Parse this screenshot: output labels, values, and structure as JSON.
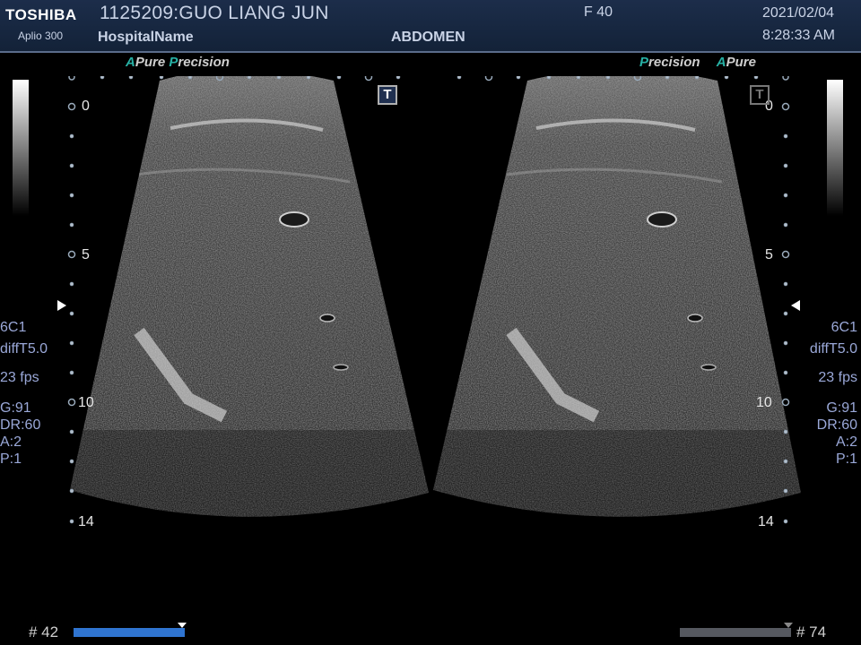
{
  "header": {
    "logo": "TOSHIBA",
    "model": "Aplio 300",
    "patient": "1125209:GUO LIANG JUN",
    "hospital": "HospitalName",
    "frame_rate_label": "F 40",
    "preset": "ABDOMEN",
    "date": "2021/02/04",
    "time": "8:28:33 AM"
  },
  "brand_left": {
    "a": "A",
    "pure": "Pure",
    "p": "P",
    "precision": "recision"
  },
  "brand_right": {
    "p": "P",
    "precision": "recision",
    "a": "A",
    "pure": "Pure"
  },
  "scale": {
    "d0": "0",
    "d5": "5",
    "d10": "10",
    "d14": "14"
  },
  "left_params": {
    "probe": "6C1",
    "mode": "diffT5.0",
    "fps": "23 fps",
    "gain": "G:91",
    "dr": "DR:60",
    "a": "A:2",
    "p": "P:1"
  },
  "right_params": {
    "probe": "6C1",
    "mode": "diffT5.0",
    "fps": "23 fps",
    "gain": "G:91",
    "dr": "DR:60",
    "a": "A:2",
    "p": "P:1"
  },
  "tbutton": "T",
  "footer": {
    "left_frame": "# 42",
    "right_frame": "# 74",
    "left_progress": 1.0,
    "right_progress": 1.0
  },
  "colors": {
    "accent": "#27b1a5",
    "cine_active": "#2f74d0",
    "cine_inactive": "#55585f",
    "param_text": "#9aa8d8"
  }
}
